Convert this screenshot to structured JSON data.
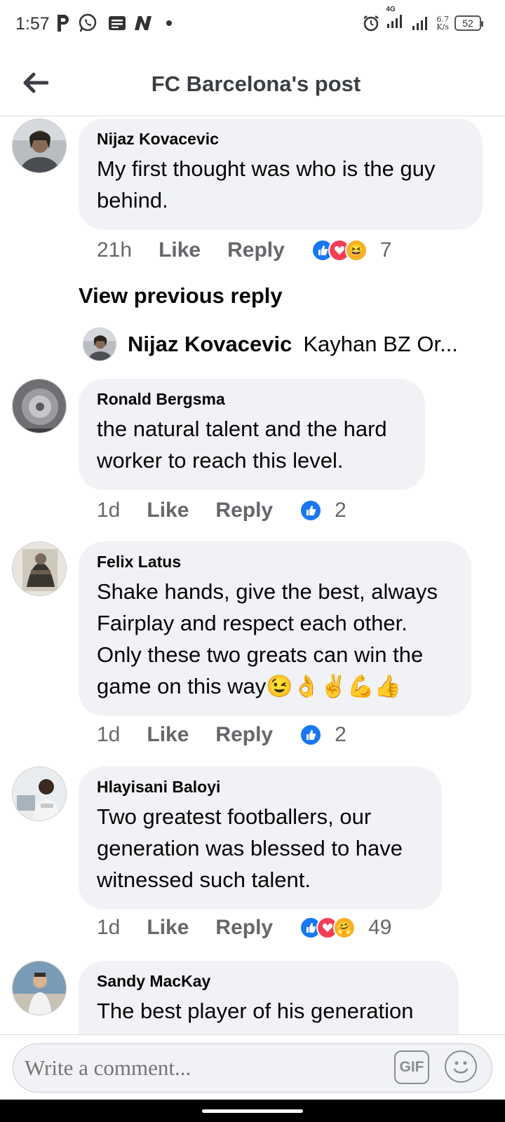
{
  "status_bar": {
    "time": "1:57",
    "network": "4G",
    "speed_value": "6.7",
    "speed_unit": "K/s",
    "battery": "52"
  },
  "header": {
    "title": "FC Barcelona's post"
  },
  "comments": [
    {
      "author": "Nijaz Kovacevic",
      "text": "My first thought was who is the guy behind.",
      "time": "21h",
      "like_label": "Like",
      "reply_label": "Reply",
      "reactions": [
        "like",
        "love",
        "haha"
      ],
      "reaction_count": "7"
    },
    {
      "author": "Ronald Bergsma",
      "text": "the natural talent and the hard worker to reach this level.",
      "time": "1d",
      "like_label": "Like",
      "reply_label": "Reply",
      "reactions": [
        "like"
      ],
      "reaction_count": "2"
    },
    {
      "author": "Felix Latus",
      "text": "Shake hands, give the best, always Fairplay and respect each other. Only these two greats can win the game on this way😉👌✌💪👍",
      "time": "1d",
      "like_label": "Like",
      "reply_label": "Reply",
      "reactions": [
        "like"
      ],
      "reaction_count": "2"
    },
    {
      "author": "Hlayisani Baloyi",
      "text": "Two greatest footballers, our generation was blessed to have witnessed such talent.",
      "time": "1d",
      "like_label": "Like",
      "reply_label": "Reply",
      "reactions": [
        "like",
        "love",
        "care"
      ],
      "reaction_count": "49"
    },
    {
      "author": "Sandy MacKay",
      "text": "The best player of his generation"
    }
  ],
  "replies": {
    "view_previous_label": "View previous reply",
    "preview_author": "Nijaz Kovacevic",
    "preview_snippet": "Kayhan BZ Or..."
  },
  "composer": {
    "placeholder": "Write a comment...",
    "gif_label": "GIF"
  },
  "colors": {
    "bubble": "#f0f2f5",
    "like_blue": "#1877f2",
    "love_red": "#f33e58",
    "haha_yellow": "#f7b125",
    "secondary_text": "#65676b"
  }
}
